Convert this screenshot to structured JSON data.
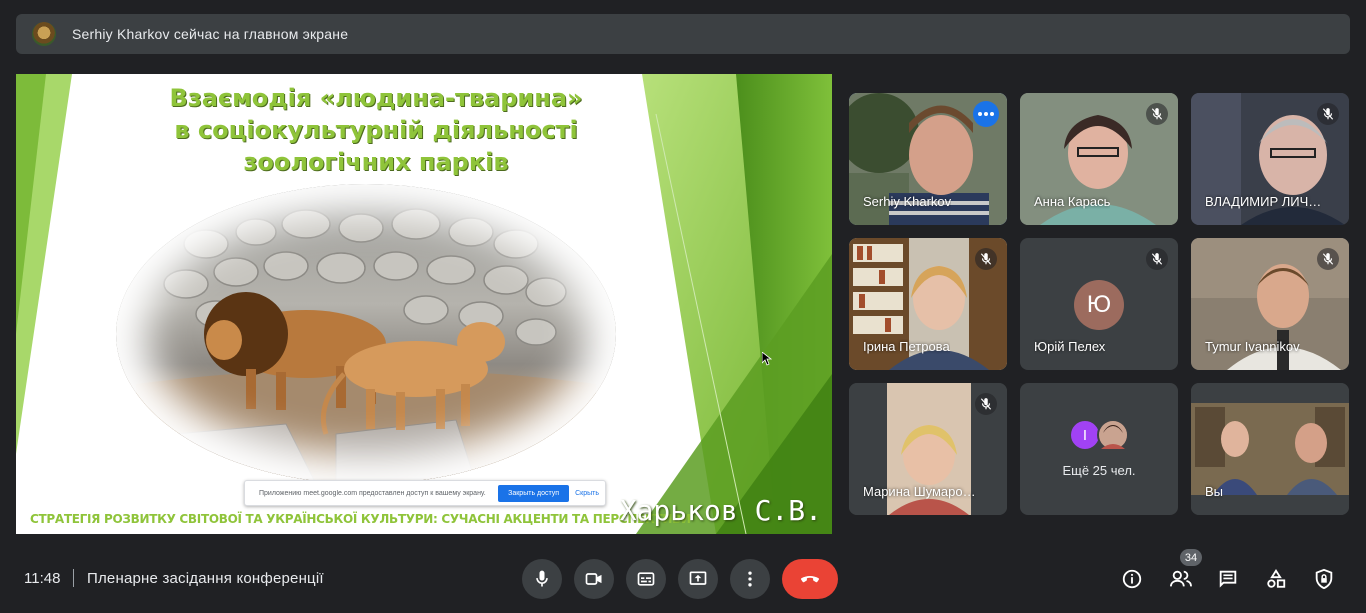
{
  "banner": {
    "text": "Serhiy Kharkov сейчас на главном экране",
    "avatar_icon": "zoo-logo-icon"
  },
  "presentation": {
    "title_lines": [
      "Взаємодія «людина-тварина»",
      "в соціокультурній діяльності",
      "зоологічних парків"
    ],
    "photo_subject": "lions",
    "footer": "СТРАТЕГІЯ РОЗВИТКУ СВІТОВОЇ ТА УКРАЇНСЬКОЇ КУЛЬТУРИ: СУЧАСНІ АКЦЕНТИ ТА ПЕРСПЕКТИВИ",
    "author": "Харьков С.В.",
    "share_notice": {
      "text": "Приложению meet.google.com предоставлен доступ к вашему экрану.",
      "stop_button": "Закрыть доступ",
      "hide_link": "Скрыть"
    }
  },
  "participants": [
    {
      "name": "Serhiy Kharkov",
      "muted": false,
      "active": true
    },
    {
      "name": "Анна Карась",
      "muted": true
    },
    {
      "name": "ВЛАДИМИР ЛИЧ…",
      "muted": true
    },
    {
      "name": "Ірина Петрова",
      "muted": true
    },
    {
      "name": "Юрій Пелех",
      "muted": true,
      "initial": "Ю"
    },
    {
      "name": "Tymur Ivannikov",
      "muted": true
    },
    {
      "name": "Марина Шумаро…",
      "muted": true
    },
    {
      "name": "Вы",
      "muted": false
    }
  ],
  "more_tile": {
    "count_label": "Ещё 25 чел.",
    "initial": "I"
  },
  "bottom": {
    "time": "11:48",
    "meeting_title": "Пленарне засідання конференції",
    "people_count": "34"
  },
  "colors": {
    "background": "#202124",
    "tile": "#3c4043",
    "accent_blue": "#1a73e8",
    "end_call_red": "#ea4335",
    "slide_green": "#8fc43a"
  }
}
